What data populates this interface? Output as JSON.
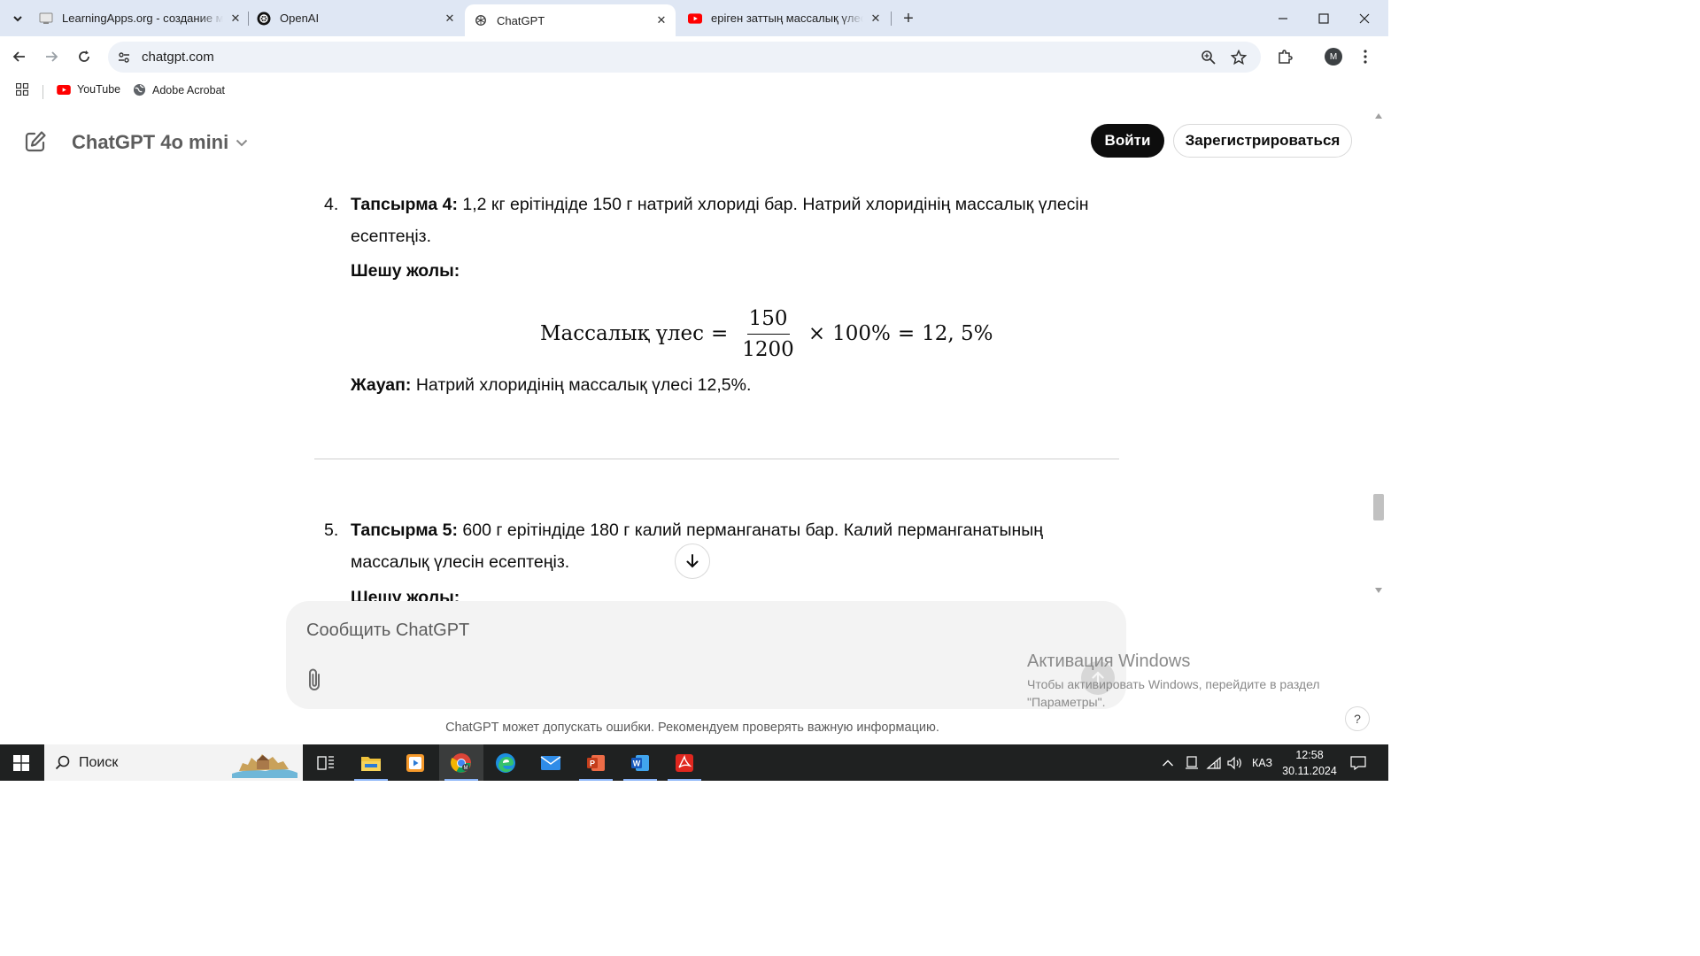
{
  "browser": {
    "tabs": [
      {
        "title": "LearningApps.org - создание мультимедийных",
        "active": false,
        "favicon": "learningapps-icon"
      },
      {
        "title": "OpenAI",
        "active": false,
        "favicon": "openai-icon"
      },
      {
        "title": "ChatGPT",
        "active": true,
        "favicon": "openai-icon"
      },
      {
        "title": "еріген заттың массалық үлесін",
        "active": false,
        "favicon": "youtube-icon"
      }
    ],
    "url": "chatgpt.com",
    "profile_initial": "M",
    "bookmarks": [
      {
        "label": "YouTube",
        "icon": "youtube-icon"
      },
      {
        "label": "Adobe Acrobat",
        "icon": "globe-icon"
      }
    ]
  },
  "header": {
    "model_label": "ChatGPT 4o mini",
    "login_label": "Войти",
    "signup_label": "Зарегистрироваться"
  },
  "content": {
    "task4": {
      "number": "4.",
      "title": "Тапсырма 4:",
      "text": " 1,2 кг ерітіндіде 150 г натрий хлориді бар. Натрий хлоридінің массалық үлесін есептеңіз.",
      "solution_title": "Шешу жолы:",
      "formula": {
        "lhs": "Массалық үлес",
        "eq": "=",
        "numerator": "150",
        "denominator": "1200",
        "times": "×",
        "percent": "100%",
        "eq2": "=",
        "result": "12, 5%"
      },
      "answer_title": "Жауап:",
      "answer_text": " Натрий хлоридінің массалық үлесі 12,5%."
    },
    "task5": {
      "number": "5.",
      "title": "Тапсырма 5:",
      "text": " 600 г ерітіндіде 180 г калий перманганаты бар. Калий перманганатының массалық үлесін есептеңіз.",
      "solution_title": "Шешу жолы:"
    }
  },
  "composer": {
    "placeholder": "Сообщить ChatGPT"
  },
  "disclaimer": "ChatGPT может допускать ошибки. Рекомендуем проверять важную информацию.",
  "help_label": "?",
  "activation": {
    "title": "Активация Windows",
    "text": "Чтобы активировать Windows, перейдите в раздел \"Параметры\"."
  },
  "taskbar": {
    "search_label": "Поиск",
    "language": "КАЗ",
    "time": "12:58",
    "date": "30.11.2024",
    "apps": [
      "task-view-icon",
      "file-explorer-icon",
      "media-player-icon",
      "chrome-icon",
      "edge-icon",
      "mail-icon",
      "powerpoint-icon",
      "word-icon",
      "acrobat-icon"
    ]
  }
}
